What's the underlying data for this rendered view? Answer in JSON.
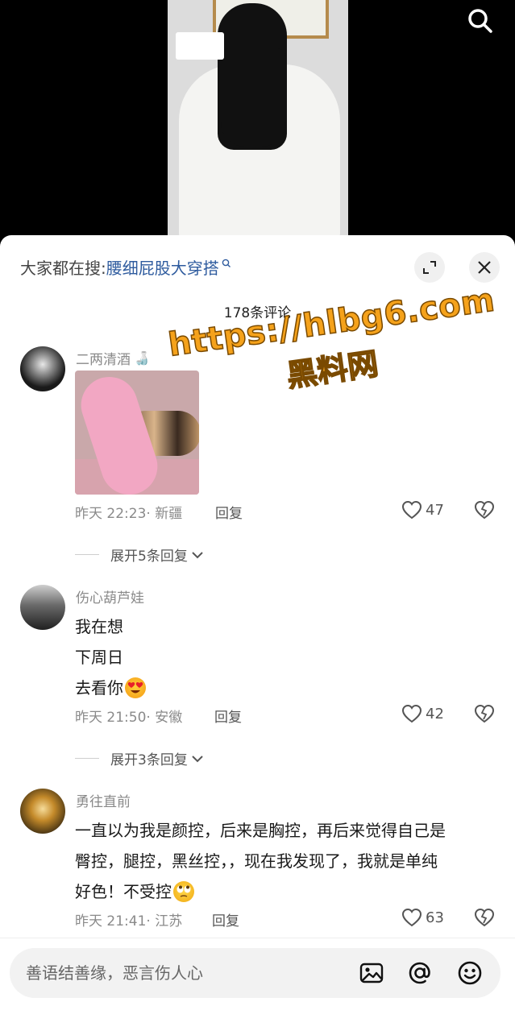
{
  "video": {
    "sticker_text": "",
    "search_icon": "search-icon"
  },
  "panel": {
    "search_label": "大家都在搜:",
    "search_term": "腰细屁股大穿搭",
    "comment_count": "178条评论"
  },
  "watermark": {
    "url": "https://hlbg6.com",
    "name": "黑料网"
  },
  "comments": [
    {
      "username": "二两清酒",
      "username_emoji": "🍶",
      "has_image": true,
      "lines": [],
      "time": "昨天 22:23",
      "location": "新疆",
      "meta": "昨天 22:23· 新疆",
      "reply": "回复",
      "likes": "47",
      "expand_replies": "展开5条回复"
    },
    {
      "username": "伤心葫芦娃",
      "lines": [
        "我在想",
        "下周日",
        "去看你"
      ],
      "meta": "昨天 21:50· 安徽",
      "reply": "回复",
      "likes": "42",
      "expand_replies": "展开3条回复"
    },
    {
      "username": "勇往直前",
      "lines": [
        "一直以为我是颜控，后来是胸控，再后来觉得自己是",
        "臀控，腿控，黑丝控，，现在我发现了，我就是单纯",
        "好色！不受控"
      ],
      "meta": "昨天 21:41· 江苏",
      "reply": "回复",
      "likes": "63"
    }
  ],
  "input": {
    "placeholder": "善语结善缘，恶言伤人心"
  },
  "colors": {
    "accent": "#2e5b9e",
    "watermark": "#f5a21b"
  }
}
